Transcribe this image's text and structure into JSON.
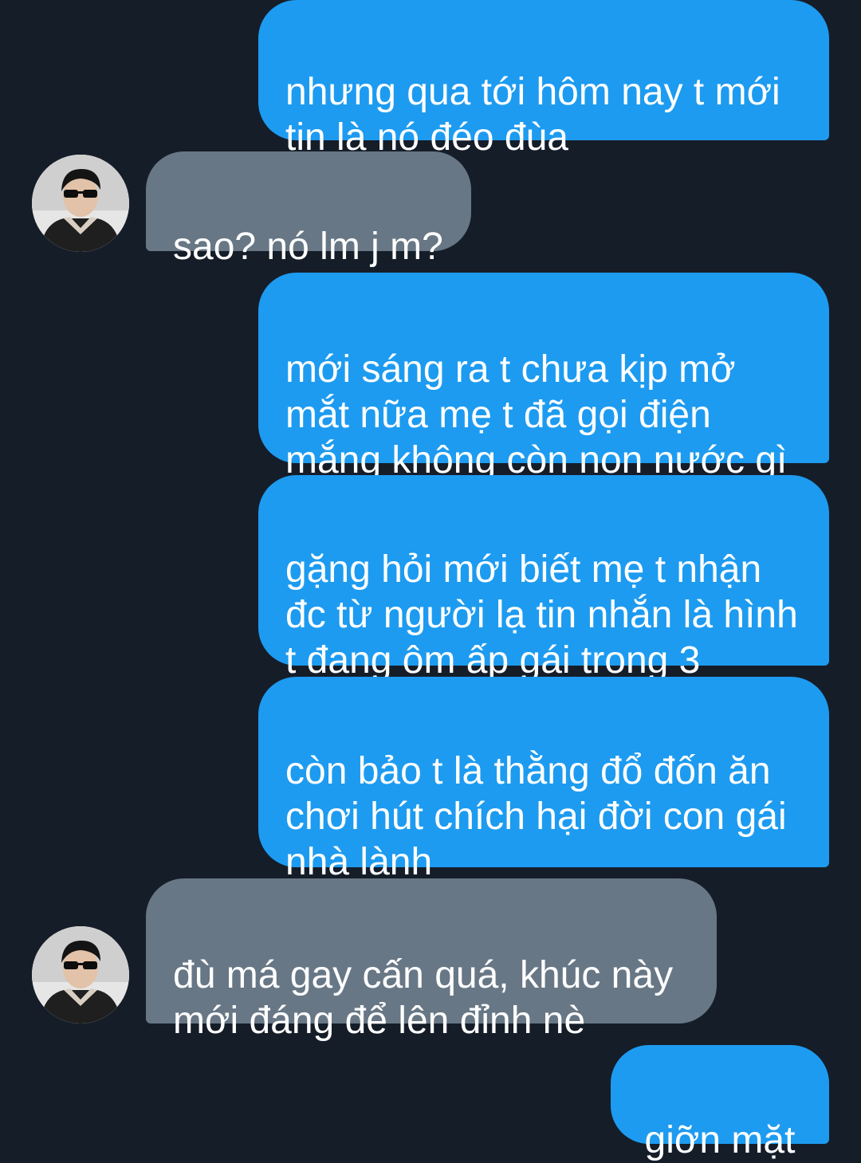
{
  "conversation": {
    "messages": [
      {
        "sender": "me",
        "text": "nhưng qua tới hôm nay t mới\ntin là nó đéo đùa"
      },
      {
        "sender": "other",
        "text": "sao? nó lm j m?",
        "avatar_icon": "user-avatar-sunglasses"
      },
      {
        "sender": "me",
        "text": "mới sáng ra t chưa kịp mở\nmắt nữa mẹ t đã gọi điện\nmắng không còn non nước gì"
      },
      {
        "sender": "me",
        "text": "gặng hỏi mới biết mẹ t nhận\nđc từ người lạ tin nhắn là hình\nt đang ôm ấp gái trong 3"
      },
      {
        "sender": "me",
        "text": "còn bảo t là thằng đổ đốn ăn\nchơi hút chích hại đời con gái\nnhà lành"
      },
      {
        "sender": "other",
        "text": "đù má gay cấn quá, khúc này\nmới đáng để lên đỉnh nè",
        "avatar_icon": "user-avatar-sunglasses"
      },
      {
        "sender": "me",
        "text": "giỡn mặt"
      }
    ]
  },
  "colors": {
    "background": "#151d29",
    "sent_bubble": "#1d9bf0",
    "received_bubble": "#687785",
    "text": "#ffffff"
  }
}
